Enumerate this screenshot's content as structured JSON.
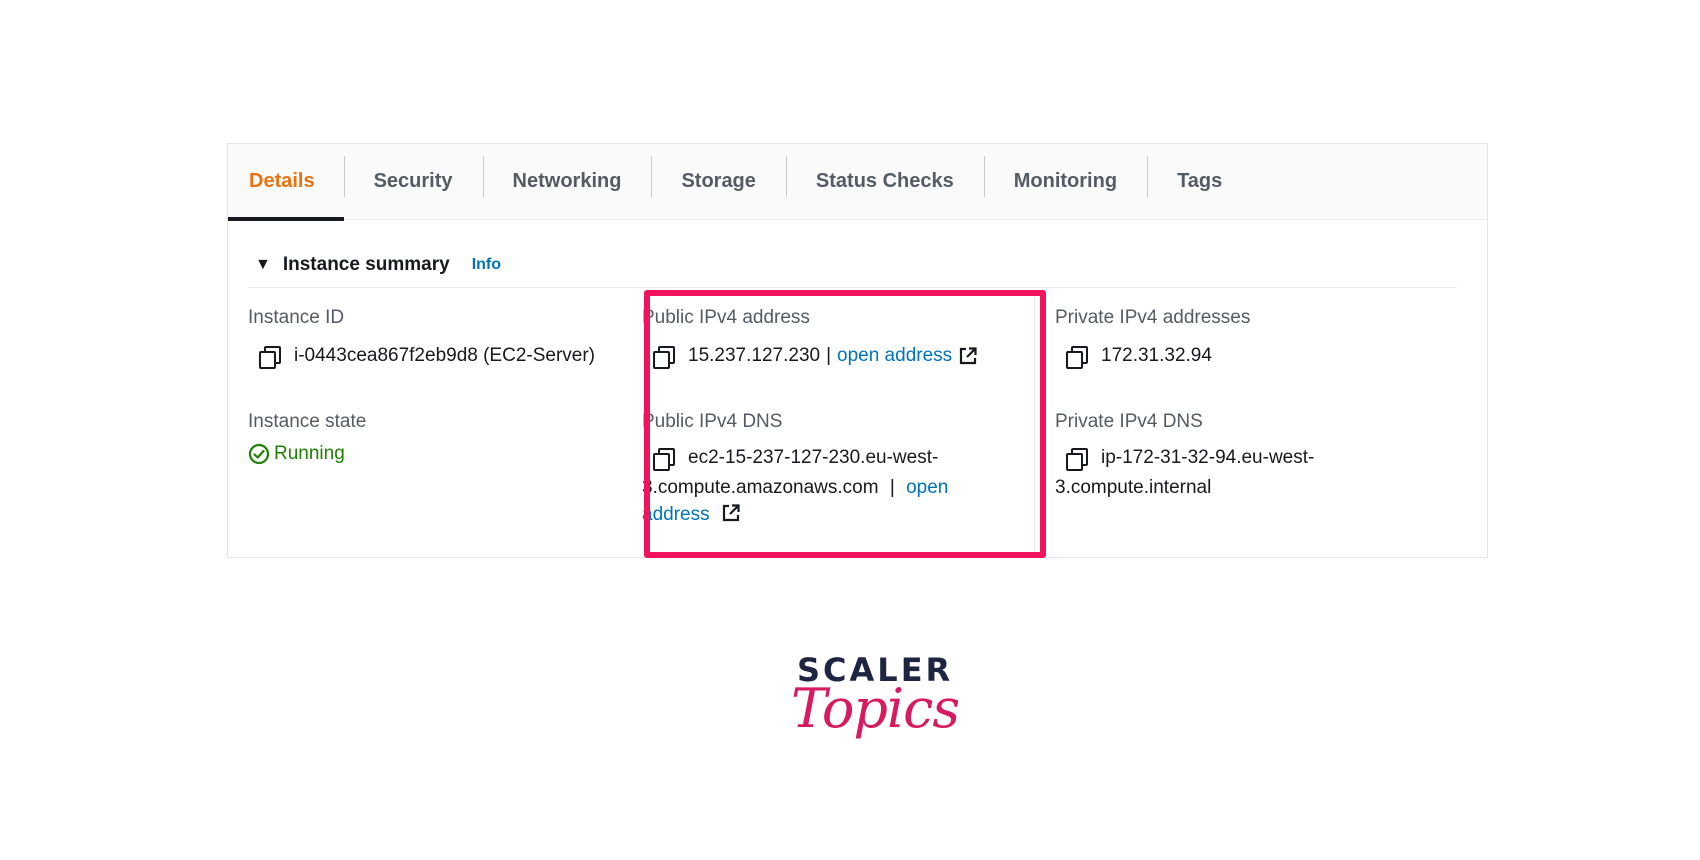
{
  "tabs": [
    {
      "label": "Details",
      "active": true
    },
    {
      "label": "Security"
    },
    {
      "label": "Networking"
    },
    {
      "label": "Storage"
    },
    {
      "label": "Status Checks"
    },
    {
      "label": "Monitoring"
    },
    {
      "label": "Tags"
    }
  ],
  "summary": {
    "title": "Instance summary",
    "info_label": "Info"
  },
  "instance_id": {
    "label": "Instance ID",
    "value": "i-0443cea867f2eb9d8 (EC2-Server)"
  },
  "instance_state": {
    "label": "Instance state",
    "value": "Running"
  },
  "public_ipv4": {
    "label": "Public IPv4 address",
    "value": "15.237.127.230",
    "link": "open address"
  },
  "public_dns": {
    "label": "Public IPv4 DNS",
    "line1": "ec2-15-237-127-230.eu-west-",
    "line2": "3.compute.amazonaws.com",
    "link_part1": "open",
    "link_part2": "address"
  },
  "private_ipv4": {
    "label": "Private IPv4 addresses",
    "value": "172.31.32.94"
  },
  "private_dns": {
    "label": "Private IPv4 DNS",
    "line1": "ip-172-31-32-94.eu-west-",
    "line2": "3.compute.internal"
  },
  "brand": {
    "line1": "SCALER",
    "line2": "Topics"
  },
  "colors": {
    "active_tab": "#ec7211",
    "link": "#0073bb",
    "running": "#1d8102",
    "highlight": "#ef145b"
  }
}
